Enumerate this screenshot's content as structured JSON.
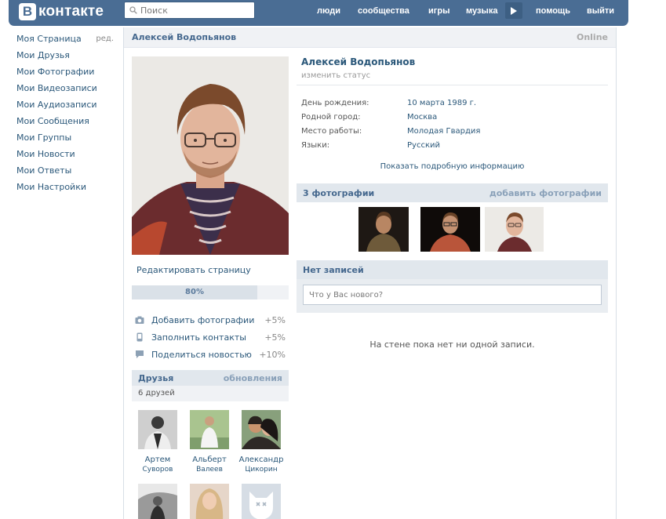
{
  "header": {
    "logo_letter": "В",
    "logo_text": "контакте",
    "search_placeholder": "Поиск",
    "nav": {
      "people": "люди",
      "groups": "сообщества",
      "games": "игры",
      "music": "музыка",
      "help": "помощь",
      "exit": "выйти"
    }
  },
  "left_menu": {
    "items": [
      "Моя Страница",
      "Мои Друзья",
      "Мои Фотографии",
      "Мои Видеозаписи",
      "Мои Аудиозаписи",
      "Мои Сообщения",
      "Мои Группы",
      "Мои Новости",
      "Мои Ответы",
      "Мои Настройки"
    ],
    "edit_label": "ред."
  },
  "page": {
    "title_name": "Алексей Водопьянов",
    "online": "Online"
  },
  "profile": {
    "edit_page": "Редактировать страницу",
    "progress_value": 0.8,
    "progress_label": "80%",
    "tips": [
      {
        "label": "Добавить фотографии",
        "value": "+5%",
        "icon": "camera-icon"
      },
      {
        "label": "Заполнить контакты",
        "value": "+5%",
        "icon": "phone-icon"
      },
      {
        "label": "Поделиться новостью",
        "value": "+10%",
        "icon": "speech-bubble-icon"
      }
    ],
    "friends": {
      "title": "Друзья",
      "updates": "обновления",
      "count": "6 друзей",
      "list": [
        {
          "first": "Артем",
          "last": "Суворов"
        },
        {
          "first": "Альберт",
          "last": "Валеев"
        },
        {
          "first": "Александр",
          "last": "Цикорин"
        }
      ]
    }
  },
  "info": {
    "name": "Алексей Водопьянов",
    "status": "изменить статус",
    "rows": [
      {
        "label": "День рождения:",
        "value": "10 марта 1989 г."
      },
      {
        "label": "Родной город:",
        "value": "Москва"
      },
      {
        "label": "Место работы:",
        "value": "Молодая Гвардия"
      },
      {
        "label": "Языки:",
        "value": "Русский"
      }
    ],
    "more": "Показать подробную информацию"
  },
  "photos": {
    "title": "3 фотографии",
    "add": "добавить фотографии"
  },
  "wall": {
    "title": "Нет записей",
    "placeholder": "Что у Вас нового?",
    "empty": "На стене пока нет ни одной записи."
  },
  "colors": {
    "header_blue": "#4a6d94",
    "link": "#2b587a",
    "section_bg": "#e1e7ed"
  }
}
